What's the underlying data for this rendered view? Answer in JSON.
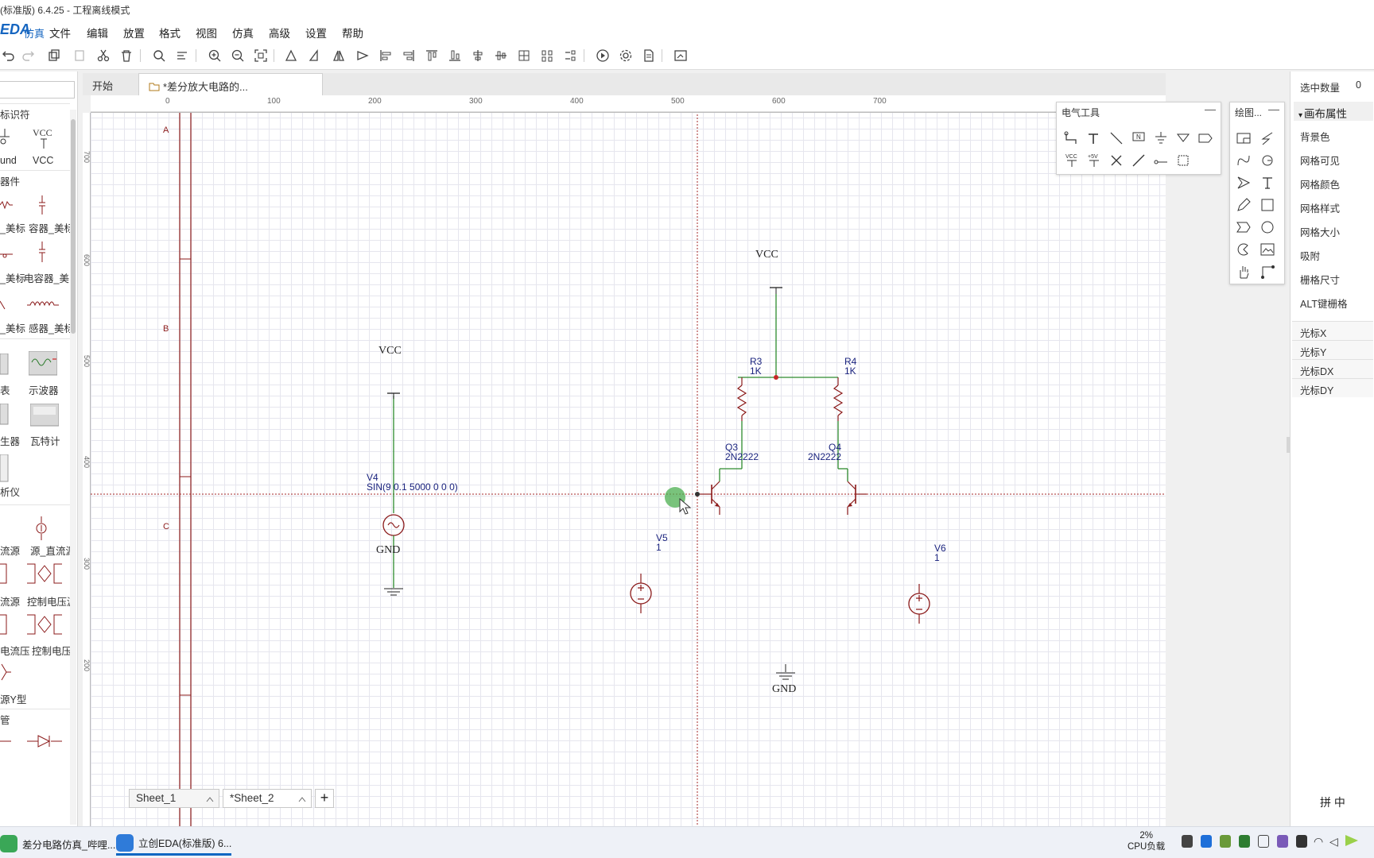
{
  "window": {
    "title": "(标准版) 6.4.25 - 工程离线模式"
  },
  "menubar": {
    "logo": "EDA",
    "logo_sub": "仿真",
    "items": [
      "文件",
      "编辑",
      "放置",
      "格式",
      "视图",
      "仿真",
      "高级",
      "设置",
      "帮助"
    ]
  },
  "tabs": [
    {
      "label": "开始"
    },
    {
      "label": "*差分放大电路的..."
    }
  ],
  "left_panel": {
    "sections": [
      "标识符",
      "器件",
      "管"
    ],
    "symbols": [
      "und",
      "VCC"
    ],
    "components": [
      "_美标",
      "容器_美标",
      "_美标",
      "电容器_美",
      "_美标",
      "感器_美标",
      "表",
      "示波器",
      "生器",
      "瓦特计",
      "析仪",
      "流源",
      "源_直流源",
      "流源",
      "控制电压源",
      "电流压",
      "控制电压",
      "源Y型"
    ]
  },
  "ruler": {
    "top": [
      "0",
      "100",
      "200",
      "300",
      "400",
      "500",
      "600",
      "700"
    ],
    "left": [
      "700",
      "600",
      "500",
      "400",
      "300",
      "200"
    ]
  },
  "frame": {
    "zones": [
      "A",
      "B",
      "C"
    ]
  },
  "schematic": {
    "vcc_label": "VCC",
    "gnd_label": "GND",
    "components": [
      {
        "ref": "V4",
        "value": "SIN(9 0.1 5000 0 0 0)"
      },
      {
        "ref": "V5",
        "value": "1"
      },
      {
        "ref": "V6",
        "value": "1"
      },
      {
        "ref": "R3",
        "value": "1K"
      },
      {
        "ref": "R4",
        "value": "1K"
      },
      {
        "ref": "Q3",
        "value": "2N2222"
      },
      {
        "ref": "Q4",
        "value": "2N2222"
      }
    ],
    "wire_color": "#2e8b2e",
    "part_color": "#8b1a1a",
    "label_color": "#1a237e"
  },
  "electrical_tools": {
    "title": "电气工具",
    "minimize": "—"
  },
  "drawing_tools": {
    "title": "绘图...",
    "minimize": "—"
  },
  "sheets": [
    {
      "label": "Sheet_1"
    },
    {
      "label": "*Sheet_2"
    }
  ],
  "sheet_add": "+",
  "right_panel": {
    "selected_label": "选中数量",
    "selected_value": "0",
    "header": "画布属性",
    "props": [
      "背景色",
      "网格可见",
      "网格颜色",
      "网格样式",
      "网格大小",
      "吸附",
      "栅格尺寸",
      "ALT键栅格"
    ],
    "cursor_rows": [
      "光标X",
      "光标Y",
      "光标DX",
      "光标DY"
    ]
  },
  "taskbar": {
    "tasks": [
      {
        "label": "差分电路仿真_哔哩..."
      },
      {
        "label": "立创EDA(标准版) 6..."
      }
    ],
    "cpu_percent": "2%",
    "cpu_label": "CPU负载",
    "ime": [
      "拼",
      "中"
    ]
  }
}
